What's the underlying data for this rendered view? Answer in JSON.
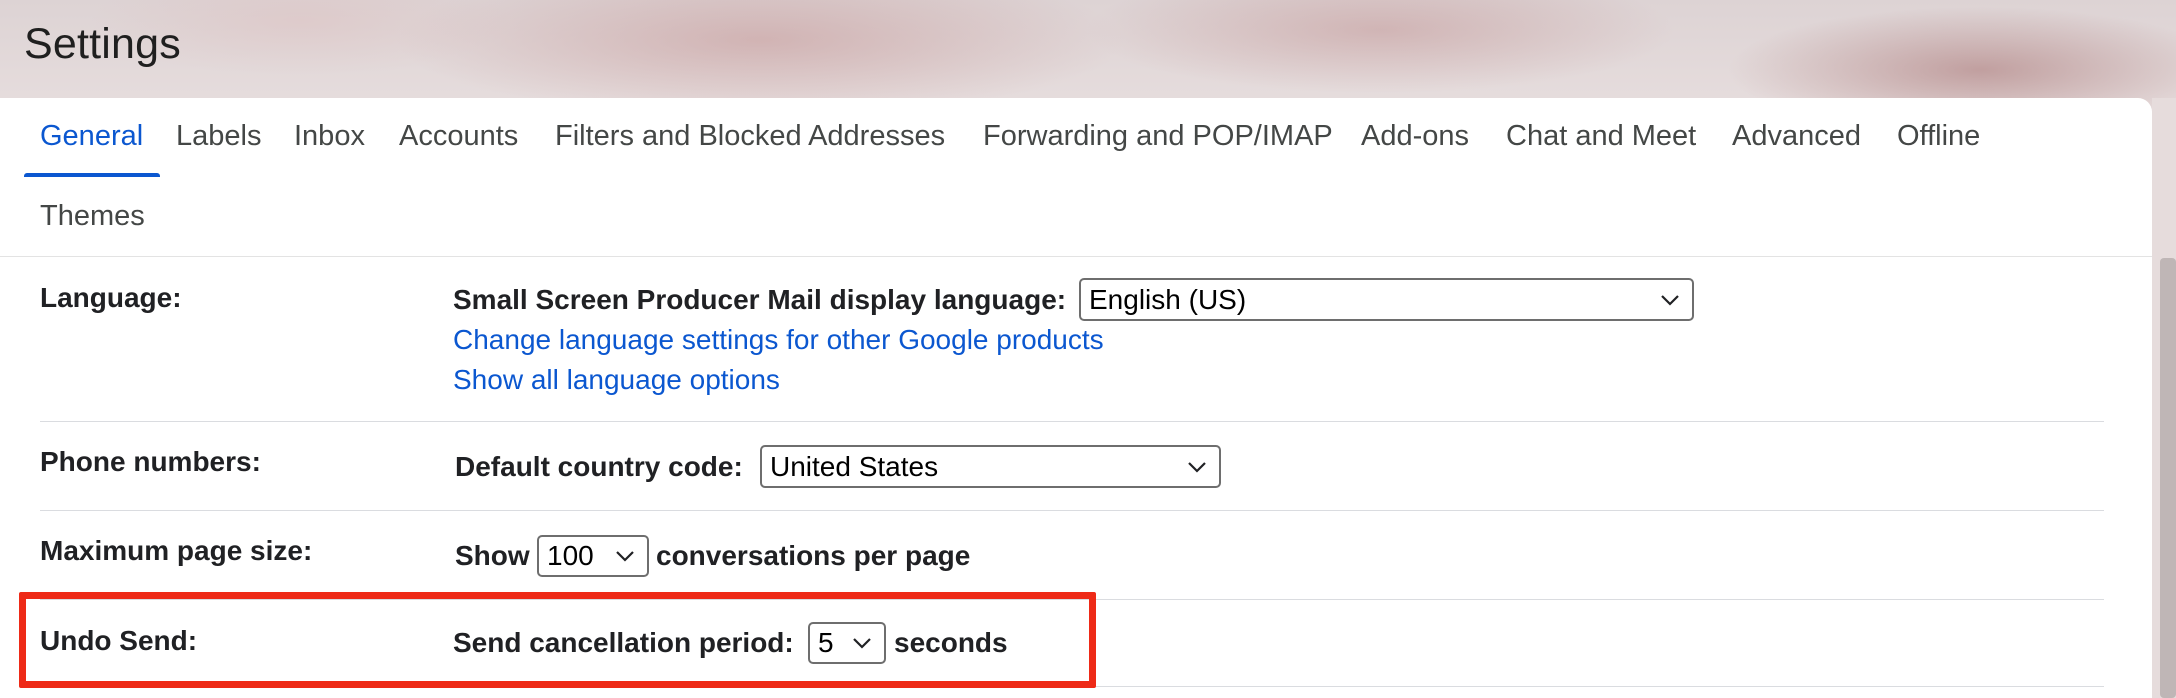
{
  "page": {
    "title": "Settings"
  },
  "tabs": [
    {
      "label": "General",
      "active": true
    },
    {
      "label": "Labels"
    },
    {
      "label": "Inbox"
    },
    {
      "label": "Accounts"
    },
    {
      "label": "Filters and Blocked Addresses"
    },
    {
      "label": "Forwarding and POP/IMAP"
    },
    {
      "label": "Add-ons"
    },
    {
      "label": "Chat and Meet"
    },
    {
      "label": "Advanced"
    },
    {
      "label": "Offline"
    },
    {
      "label": "Themes"
    }
  ],
  "settings": {
    "language": {
      "label": "Language:",
      "display_language_label": "Small Screen Producer Mail display language:",
      "display_language_value": "English (US)",
      "change_link": "Change language settings for other Google products",
      "show_all_link": "Show all language options"
    },
    "phone": {
      "label": "Phone numbers:",
      "country_code_label": "Default country code:",
      "country_code_value": "United States"
    },
    "page_size": {
      "label": "Maximum page size:",
      "prefix": "Show",
      "value": "100",
      "suffix": "conversations per page"
    },
    "undo_send": {
      "label": "Undo Send:",
      "period_label": "Send cancellation period:",
      "value": "5",
      "suffix": "seconds"
    }
  },
  "colors": {
    "accent": "#0b57d0",
    "highlight": "#ee2a17",
    "text": "#202124"
  },
  "icons": {
    "dropdown": "chevron-down-icon"
  }
}
